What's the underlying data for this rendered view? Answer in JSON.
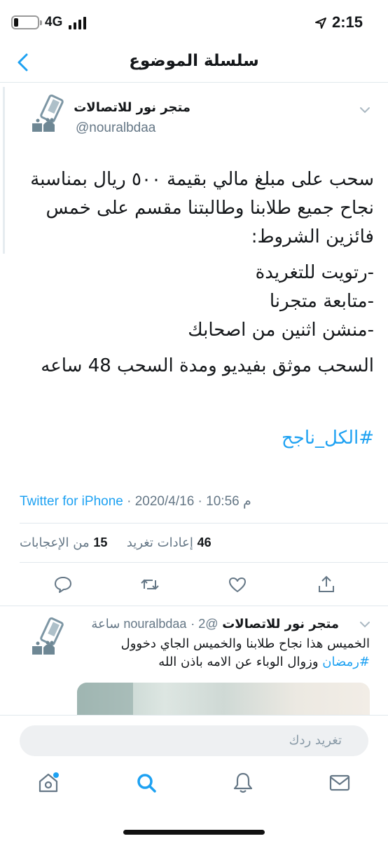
{
  "status_bar": {
    "network": "4G",
    "time": "2:15"
  },
  "nav": {
    "title": "سلسلة الموضوع"
  },
  "main_tweet": {
    "author_name": "متجر نور للاتصالات",
    "author_handle": "@nouralbdaa",
    "body": [
      "سحب على مبلغ مالي بقيمة ٥٠٠ ريال بمناسبة",
      "نجاح جميع طلابنا وطالبتنا مقسم على خمس",
      "فائزين الشروط:",
      "-رتويت للتغريدة",
      "-متابعة متجرنا",
      "-منشن اثنين من اصحابك",
      "السحب موثق بفيديو ومدة السحب 48 ساعه"
    ],
    "hashtag": "#الكل_ناجح",
    "time": "10:56 م",
    "date": "2020/4/16",
    "source": "Twitter for iPhone",
    "retweets_count": "46",
    "retweets_label": "إعادات تغريد",
    "likes_count": "15",
    "likes_label": "من الإعجابات"
  },
  "reply_tweet": {
    "author_name": "متجر نور للاتصالات",
    "author_handle": "@nouralbdaa",
    "time": "2 ساعة",
    "text_line1": "الخميس هذا نجاح طلابنا والخميس الجاي دخوول",
    "hashtag": "#رمضان",
    "text_line2_rest": " وزوال الوباء عن الامه باذن الله"
  },
  "compose": {
    "placeholder": "تغريد ردك"
  },
  "icons": {
    "back": "chevron-left-icon",
    "reply": "comment-icon",
    "retweet": "retweet-icon",
    "like": "heart-icon",
    "share": "share-icon",
    "home": "home-icon",
    "search": "search-icon",
    "notifications": "bell-icon",
    "messages": "mail-icon"
  },
  "colors": {
    "accent": "#1da1f2",
    "secondary_text": "#657786",
    "divider": "#e1e8ed"
  }
}
